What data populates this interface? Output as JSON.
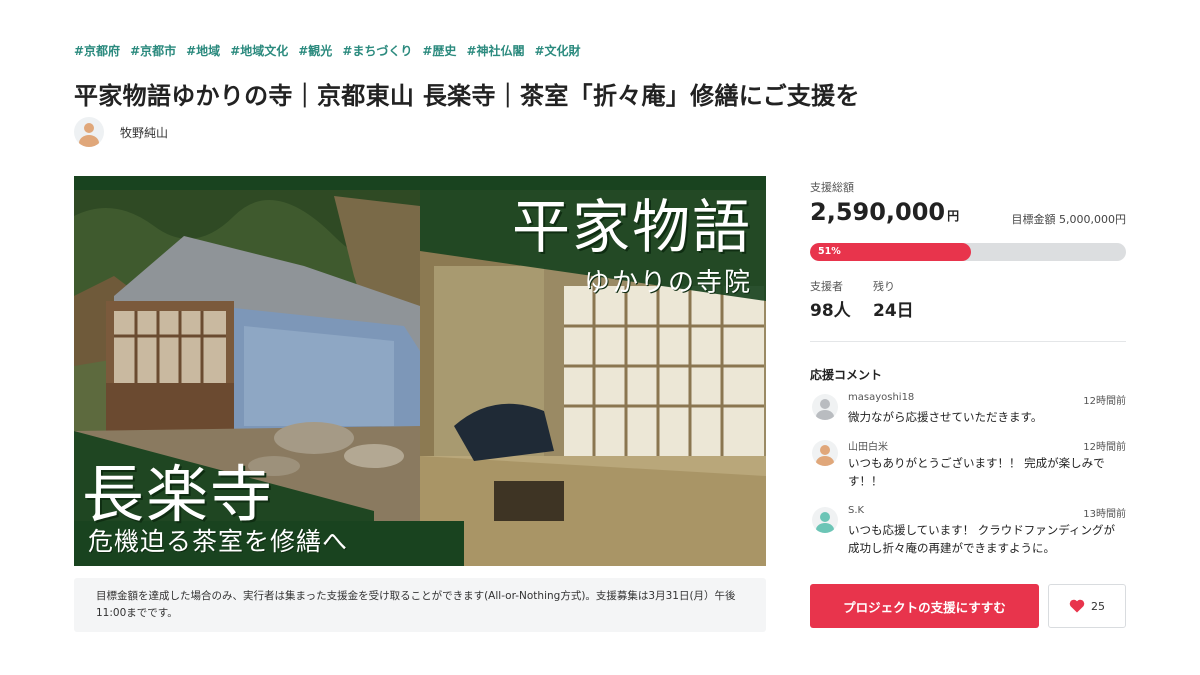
{
  "tags": [
    "#京都府",
    "#京都市",
    "#地域",
    "#地域文化",
    "#観光",
    "#まちづくり",
    "#歴史",
    "#神社仏閣",
    "#文化財"
  ],
  "title": "平家物語ゆかりの寺｜京都東山 長楽寺｜茶室「折々庵」修繕にご支援を",
  "author": {
    "name": "牧野純山",
    "icon": "avatar-icon"
  },
  "hero": {
    "heading": "平家物語",
    "subheading": "ゆかりの寺院",
    "temple": "長楽寺",
    "caption": "危機迫る茶室を修繕へ"
  },
  "notice": "目標金額を達成した場合のみ、実行者は集まった支援金を受け取ることができます(All-or-Nothing方式)。支援募集は3月31日(月）午後11:00までです。",
  "stats": {
    "total_label": "支援総額",
    "total_amount": "2,590,000",
    "total_unit": "円",
    "goal_text": "目標金額 5,000,000円",
    "progress_percent": 51,
    "progress_label": "51%",
    "supporters_label": "支援者",
    "supporters_value": "98人",
    "remaining_label": "残り",
    "remaining_value": "24日"
  },
  "comments_title": "応援コメント",
  "comments": [
    {
      "user": "masayoshi18",
      "time": "12時間前",
      "text": "微力ながら応援させていただきます。",
      "avatar_color": "#b9bcc0"
    },
    {
      "user": "山田白米",
      "time": "12時間前",
      "text": "いつもありがとうございます！！ 完成が楽しみです！！",
      "avatar_color": "#e0a77a"
    },
    {
      "user": "S.K",
      "time": "13時間前",
      "text": "いつも応援しています！ クラウドファンディングが成功し折々庵の再建ができますように。",
      "avatar_color": "#6cc5b6"
    }
  ],
  "actions": {
    "support_label": "プロジェクトの支援にすすむ",
    "like_count": "25",
    "like_icon": "heart-icon"
  },
  "colors": {
    "accent": "#e8344c",
    "tag": "#2b8a7e",
    "hero_green": "#19431f"
  }
}
